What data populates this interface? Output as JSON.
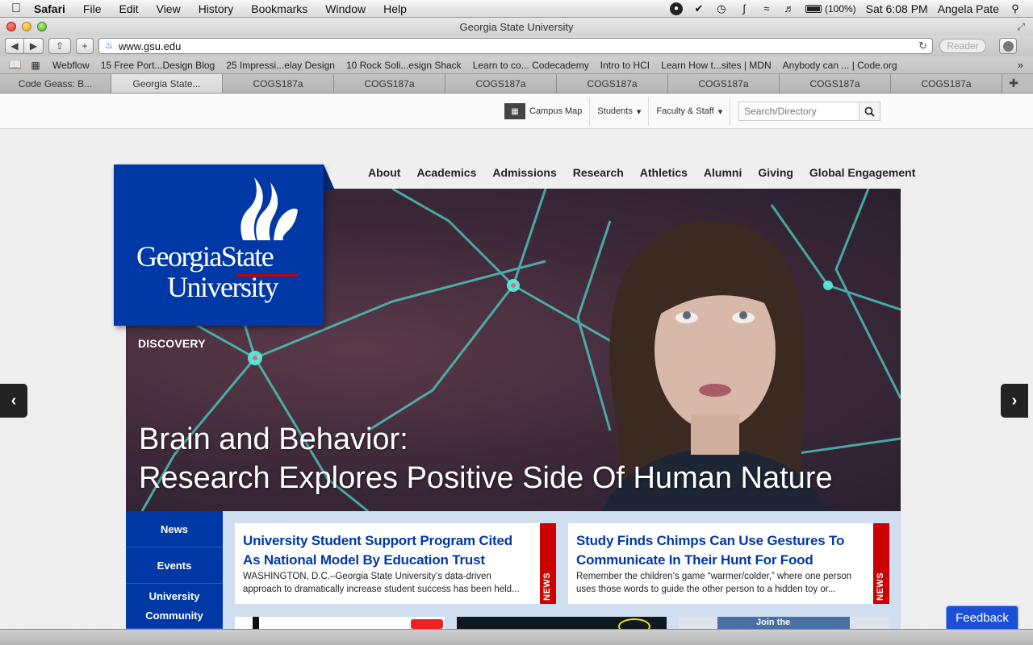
{
  "menubar": {
    "app": "Safari",
    "items": [
      "File",
      "Edit",
      "View",
      "History",
      "Bookmarks",
      "Window",
      "Help"
    ],
    "battery": "(100%)",
    "clock": "Sat 6:08 PM",
    "user": "Angela Pate"
  },
  "window": {
    "title": "Georgia State University"
  },
  "toolbar": {
    "url": "www.gsu.edu",
    "reader_label": "Reader"
  },
  "bookmarks": [
    "Webflow",
    "15 Free Port...Design Blog",
    "25 Impressi...elay Design",
    "10 Rock Soli...esign Shack",
    "Learn to co... Codecademy",
    "Intro to HCI",
    "Learn How t...sites | MDN",
    "Anybody can ... | Code.org"
  ],
  "tabs": [
    {
      "label": "Code Geass: B...",
      "active": false
    },
    {
      "label": "Georgia State...",
      "active": true
    },
    {
      "label": "COGS187a",
      "active": false
    },
    {
      "label": "COGS187a",
      "active": false
    },
    {
      "label": "COGS187a",
      "active": false
    },
    {
      "label": "COGS187a",
      "active": false
    },
    {
      "label": "COGS187a",
      "active": false
    },
    {
      "label": "COGS187a",
      "active": false
    },
    {
      "label": "COGS187a",
      "active": false
    }
  ],
  "utility": {
    "campus_map": "Campus Map",
    "students": "Students",
    "faculty": "Faculty & Staff",
    "search_placeholder": "Search/Directory"
  },
  "nav": [
    "About",
    "Academics",
    "Admissions",
    "Research",
    "Athletics",
    "Alumni",
    "Giving",
    "Global Engagement"
  ],
  "logo": {
    "line1": "GeorgiaState",
    "line2": "University"
  },
  "hero": {
    "kicker": "DISCOVERY",
    "headline_line1": "Brain and Behavior:",
    "headline_line2": "Research Explores Positive Side Of Human Nature"
  },
  "side_tabs": [
    "News",
    "Events",
    "University Community"
  ],
  "stories": [
    {
      "title": "University Student Support Program Cited As National Model By Education Trust",
      "excerpt": "WASHINGTON, D.C.–Georgia State University’s data-driven approach to dramatically increase student success has been held...",
      "tag": "NEWS"
    },
    {
      "title": "Study Finds Chimps Can Use Gestures To Communicate In Their Hunt For Food",
      "excerpt": "Remember the children’s game “warmer/colder,” where one person uses those words to guide the other person to a hidden toy or...",
      "tag": "NEWS"
    }
  ],
  "thumbs": {
    "join_text": "Join the"
  },
  "feedback_label": "Feedback",
  "colors": {
    "gsu_blue": "#0039a6",
    "news_red": "#cc0000",
    "news_bg": "#cfdff0"
  }
}
